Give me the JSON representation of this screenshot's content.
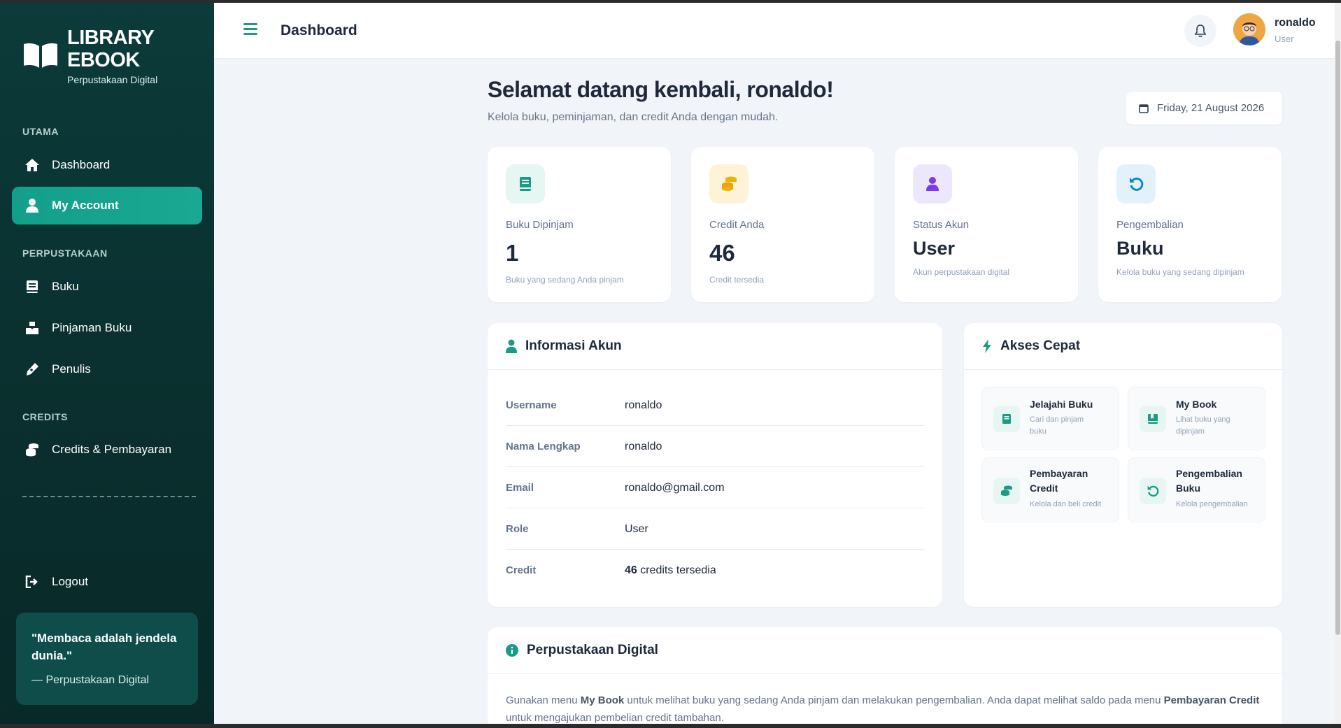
{
  "brand": {
    "title_line1": "LIBRARY",
    "title_line2": "EBOOK",
    "subtitle": "Perpustakaan Digital"
  },
  "sidebar": {
    "sections": {
      "utama": "UTAMA",
      "perpustakaan": "PERPUSTAKAAN",
      "credits": "CREDITS"
    },
    "items": [
      {
        "label": "Dashboard",
        "icon": "home-icon"
      },
      {
        "label": "My Account",
        "icon": "user-icon",
        "active": true
      },
      {
        "label": "Buku",
        "icon": "book-icon"
      },
      {
        "label": "Pinjaman Buku",
        "icon": "borrow-icon"
      },
      {
        "label": "Penulis",
        "icon": "pen-icon"
      },
      {
        "label": "Credits & Pembayaran",
        "icon": "coins-icon"
      }
    ],
    "logout": "Logout",
    "quote": {
      "text": "\"Membaca adalah jendela dunia.\"",
      "source": "— Perpustakaan Digital"
    }
  },
  "header": {
    "title": "Dashboard",
    "user_name": "ronaldo",
    "user_role": "User"
  },
  "welcome": {
    "title": "Selamat datang kembali, ronaldo!",
    "subtitle": "Kelola buku, peminjaman, dan credit Anda dengan mudah.",
    "date": "Friday, 21 August 2026"
  },
  "cards": [
    {
      "label": "Buku Dipinjam",
      "value": "1",
      "desc": "Buku yang sedang Anda pinjam",
      "icon": "book-icon",
      "color": "#e6f6f2"
    },
    {
      "label": "Credit Anda",
      "value": "46",
      "desc": "Credit tersedia",
      "icon": "coins-icon",
      "color": "#fef3d7"
    },
    {
      "label": "Status Akun",
      "value": "User",
      "desc": "Akun perpustakaan digital",
      "icon": "user-icon",
      "color": "#ede7fb"
    },
    {
      "label": "Pengembalian",
      "value": "Buku",
      "desc": "Kelola buku yang sedang dipinjam",
      "icon": "undo-icon",
      "color": "#e3f1fb"
    }
  ],
  "account_info": {
    "title": "Informasi Akun",
    "rows": [
      {
        "key": "Username",
        "value": "ronaldo"
      },
      {
        "key": "Nama Lengkap",
        "value": "ronaldo"
      },
      {
        "key": "Email",
        "value": "ronaldo@gmail.com"
      },
      {
        "key": "Role",
        "value": "User"
      },
      {
        "key": "Credit",
        "value_bold": "46",
        "value": " credits tersedia"
      }
    ]
  },
  "quick_access": {
    "title": "Akses Cepat",
    "items": [
      {
        "title": "Jelajahi Buku",
        "desc": "Cari dan pinjam buku",
        "icon": "book-icon"
      },
      {
        "title": "My Book",
        "desc": "Lihat buku yang dipinjam",
        "icon": "bookmark-book-icon"
      },
      {
        "title": "Pembayaran Credit",
        "desc": "Kelola dan beli credit",
        "icon": "coins-icon"
      },
      {
        "title": "Pengembalian Buku",
        "desc": "Kelola pengembalian",
        "icon": "undo-icon"
      }
    ]
  },
  "about": {
    "title": "Perpustakaan Digital",
    "text_1": "Gunakan menu ",
    "bold_1": "My Book",
    "text_2": " untuk melihat buku yang sedang Anda pinjam dan melakukan pengembalian. Anda dapat melihat saldo pada menu ",
    "bold_2": "Pembayaran Credit",
    "text_3": " untuk mengajukan pembelian credit tambahan."
  },
  "colors": {
    "primary": "#1a9b86",
    "sidebar_bg": "#0b3b3a",
    "bg": "#f1f5f9"
  }
}
